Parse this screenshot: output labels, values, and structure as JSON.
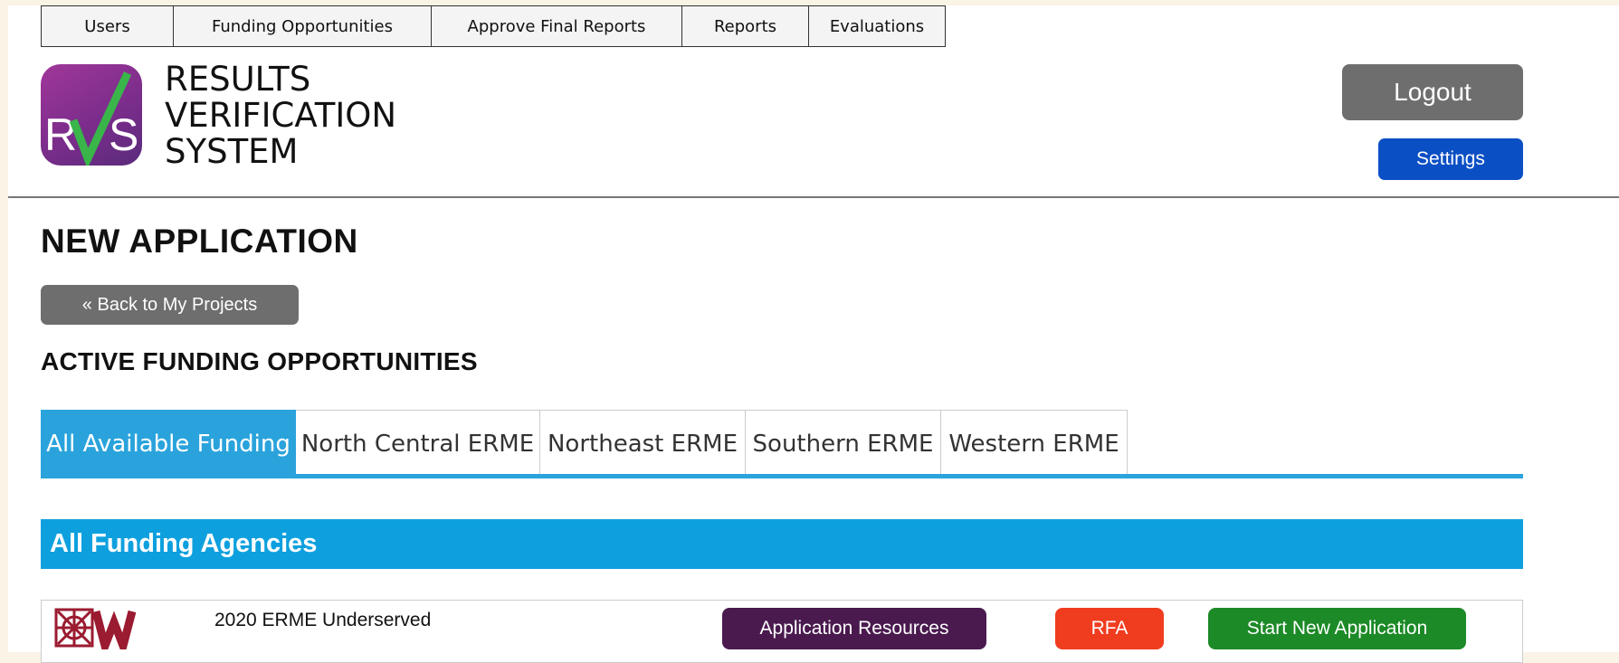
{
  "nav": {
    "items": [
      {
        "label": "Users"
      },
      {
        "label": "Funding Opportunities"
      },
      {
        "label": "Approve Final Reports"
      },
      {
        "label": "Reports"
      },
      {
        "label": "Evaluations"
      }
    ]
  },
  "brand": {
    "logo_letters": "RVS",
    "line1": "RESULTS",
    "line2": "VERIFICATION",
    "line3": "SYSTEM",
    "colors": {
      "logo_purple": "#7b2d8b",
      "logo_green": "#39b54a"
    }
  },
  "header": {
    "logout_label": "Logout",
    "settings_label": "Settings"
  },
  "page": {
    "title": "NEW APPLICATION",
    "back_label": "« Back to My Projects",
    "section_title": "ACTIVE FUNDING OPPORTUNITIES"
  },
  "tabs": [
    {
      "label": "All Available Funding",
      "active": true
    },
    {
      "label": "North Central ERME",
      "active": false
    },
    {
      "label": "Northeast ERME",
      "active": false
    },
    {
      "label": "Southern ERME",
      "active": false
    },
    {
      "label": "Western ERME",
      "active": false
    }
  ],
  "agency_section": {
    "title": "All Funding Agencies"
  },
  "opportunities": [
    {
      "agency_logo": "uw-crest-w-icon",
      "name": "2020 ERME Underserved",
      "resources_label": "Application Resources",
      "rfa_label": "RFA",
      "start_label": "Start New Application"
    }
  ],
  "colors": {
    "tab_active": "#2aa3dc",
    "agency_bar": "#0ea0de",
    "logout": "#6e6e6e",
    "settings": "#0b4fc4",
    "resources": "#4a1a4f",
    "rfa": "#f03c1f",
    "start": "#1c8a27"
  }
}
